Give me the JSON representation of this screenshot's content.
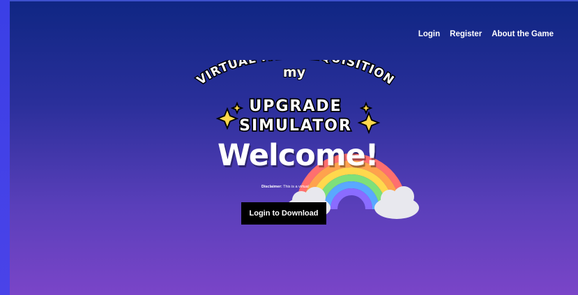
{
  "nav": {
    "login": "Login",
    "register": "Register",
    "about": "About the Game"
  },
  "logo": {
    "my": "my",
    "arc": "VIRTUAL ITEM REQUISITION",
    "line1": "UPGRADE",
    "line2": "SIMULATOR"
  },
  "hero": {
    "welcome": "Welcome!",
    "disclaimer_label": "Disclaimer:",
    "disclaimer_text": "This is a virtual",
    "cta": "Login to Download"
  },
  "colors": {
    "bg_top": "#0f2683",
    "bg_bottom": "#7a45c8",
    "button": "#000000",
    "rainbow": [
      "#ff6f6f",
      "#ffa24d",
      "#ffd84d",
      "#7ee07a",
      "#5aa8ff",
      "#8a6cff"
    ]
  }
}
